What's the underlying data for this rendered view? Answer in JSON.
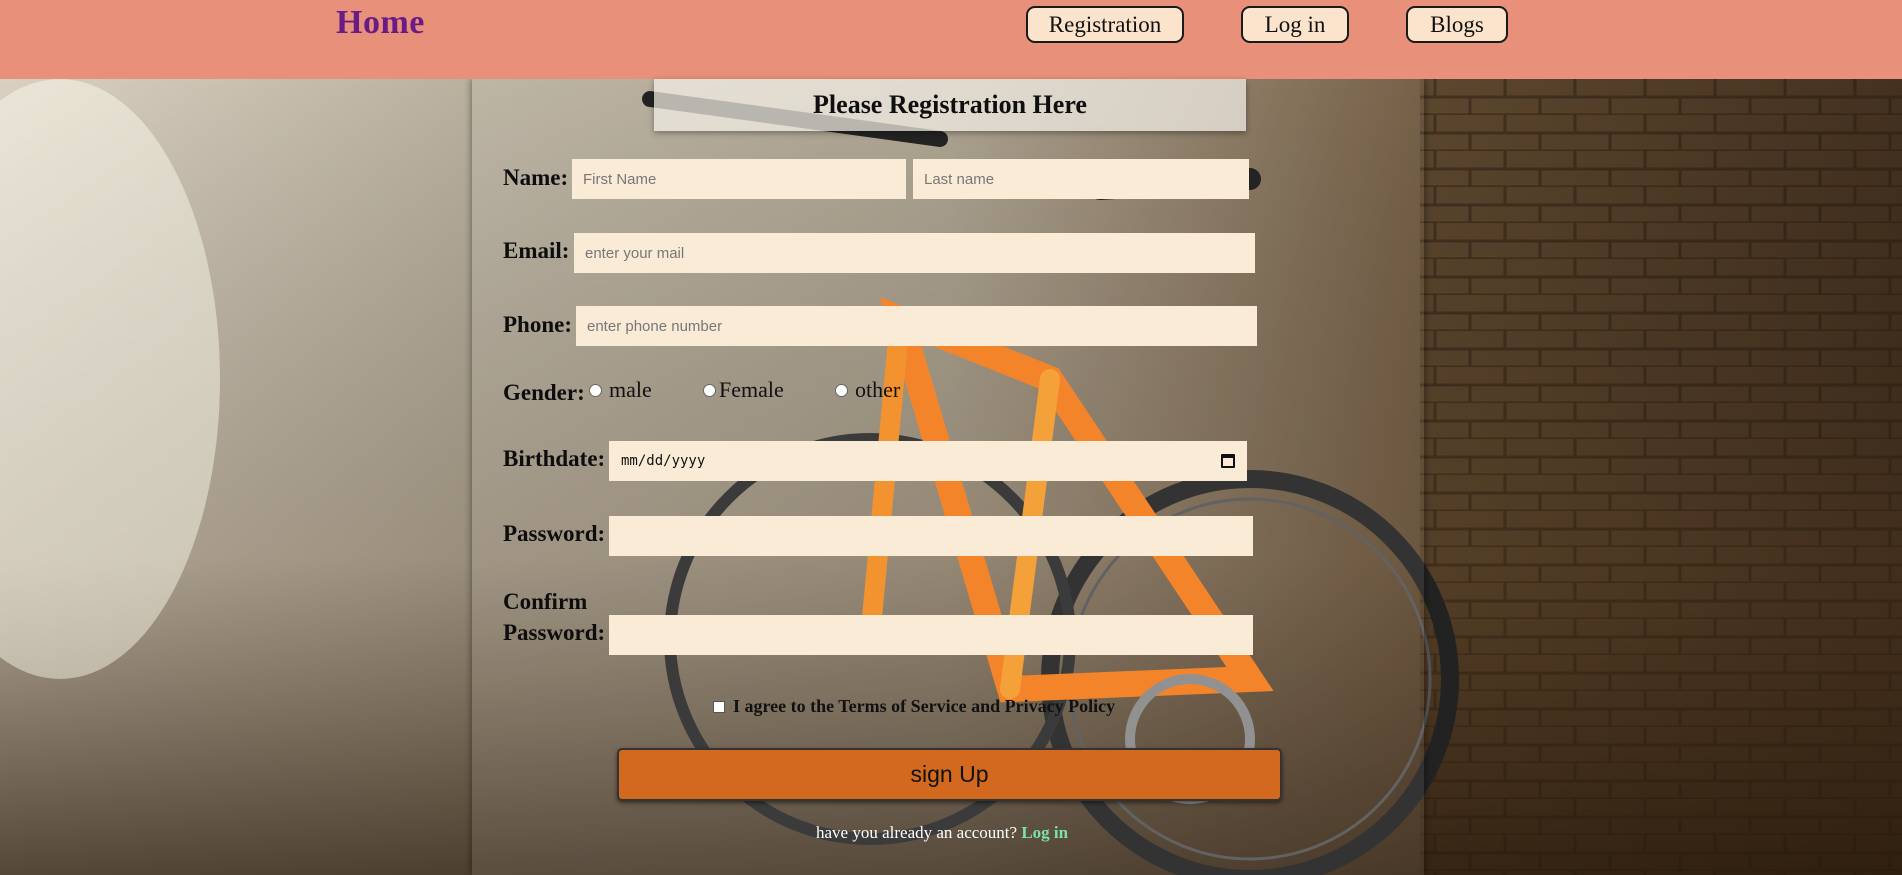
{
  "header": {
    "brand": "Home",
    "nav": [
      {
        "label": "Registration"
      },
      {
        "label": "Log in"
      },
      {
        "label": "Blogs"
      }
    ]
  },
  "form": {
    "title": "Please Registration Here",
    "name_label": "Name:",
    "first_name_placeholder": "First Name",
    "last_name_placeholder": "Last name",
    "email_label": "Email:",
    "email_placeholder": "enter your mail",
    "phone_label": "Phone:",
    "phone_placeholder": "enter phone number",
    "gender_label": "Gender:",
    "gender_options": [
      "male",
      "Female",
      "other"
    ],
    "birthdate_label": "Birthdate:",
    "birthdate_value": "mm/dd/yyyy",
    "password_label": "Password:",
    "confirm_label_line1": "Confirm",
    "confirm_label_line2": "Password:",
    "terms_text": "I agree to the Terms of Service and Privacy Policy",
    "submit_label": "sign Up",
    "footer_text": "have you already an account?",
    "footer_link": "Log in"
  },
  "icons": [
    "calendar-icon"
  ],
  "colors": {
    "header_bg": "#e8907a",
    "brand": "#6a1c86",
    "field_bg": "#faebd7",
    "submit_bg": "#d2691e",
    "login_link": "#7fe0a7"
  }
}
